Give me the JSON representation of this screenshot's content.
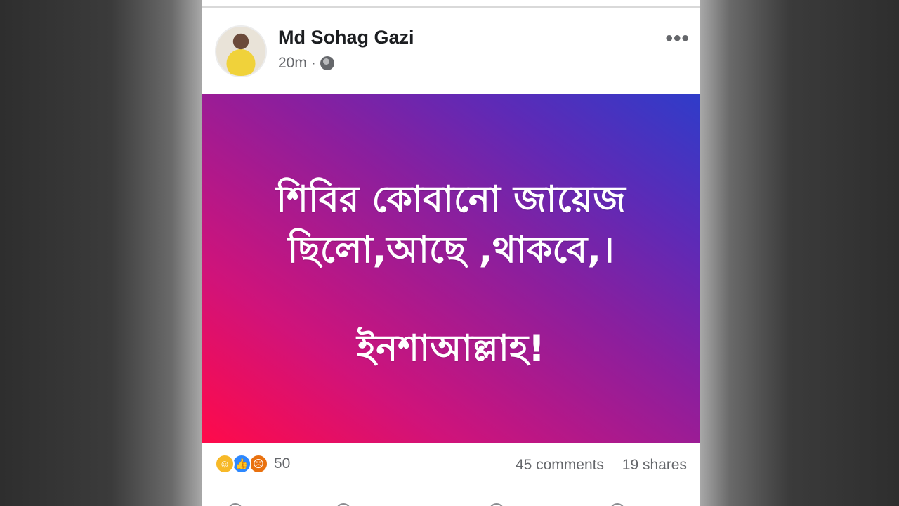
{
  "post": {
    "author": "Md Sohag Gazi",
    "time": "20m",
    "separator": "·",
    "privacy_icon": "globe-icon",
    "more_label": "•••",
    "banner": {
      "line1": "শিবির কোবানো জায়েজ",
      "line2": "ছিলো,আছে ,থাকবে,।",
      "line3": "ইনশাআল্লাহ!"
    },
    "reactions": {
      "icons": [
        "haha-reaction-icon",
        "like-reaction-icon",
        "angry-reaction-icon"
      ],
      "count": "50"
    },
    "comments": "45 comments",
    "shares": "19 shares"
  }
}
